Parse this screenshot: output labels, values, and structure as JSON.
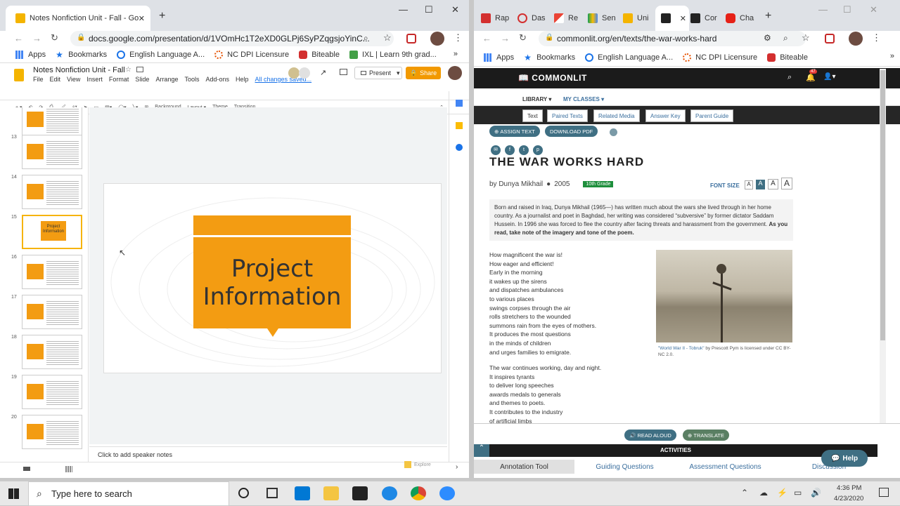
{
  "left_window": {
    "tabs": [
      {
        "title": "Notes Nonfiction Unit - Fall - Go"
      }
    ],
    "new_tab": "+",
    "url": "docs.google.com/presentation/d/1VOmHc1T2eXD0GLPj6SyPZqgsjoYinC...",
    "bookmarks": [
      {
        "label": "Apps"
      },
      {
        "label": "Bookmarks"
      },
      {
        "label": "English Language A..."
      },
      {
        "label": "NC DPI Licensure"
      },
      {
        "label": "Biteable"
      },
      {
        "label": "IXL | Learn 9th grad..."
      }
    ],
    "slides_app": {
      "doc_title": "Notes Nonfiction Unit - Fall",
      "menu": [
        "File",
        "Edit",
        "View",
        "Insert",
        "Format",
        "Slide",
        "Arrange",
        "Tools",
        "Add-ons",
        "Help"
      ],
      "saved_status": "All changes saved...",
      "present_label": "Present",
      "share_label": "Share",
      "toolbar": [
        "Background",
        "Layout ▾",
        "Theme",
        "Transition"
      ],
      "thumbnails": [
        {
          "num": ""
        },
        {
          "num": "13"
        },
        {
          "num": "14"
        },
        {
          "num": "15",
          "selected": true,
          "title": "Project Information"
        },
        {
          "num": "16"
        },
        {
          "num": "17"
        },
        {
          "num": "18"
        },
        {
          "num": "19"
        },
        {
          "num": "20"
        }
      ],
      "slide_title": "Project Information",
      "speaker_notes": "Click to add speaker notes",
      "explore_label": "Explore"
    }
  },
  "right_window": {
    "tabs": [
      {
        "title": "Rap"
      },
      {
        "title": "Das"
      },
      {
        "title": "Re"
      },
      {
        "title": "Sen"
      },
      {
        "title": "Uni"
      },
      {
        "title": ""
      },
      {
        "title": "Cor"
      },
      {
        "title": "Cha"
      }
    ],
    "new_tab": "+",
    "url": "commonlit.org/en/texts/the-war-works-hard",
    "bookmarks": [
      {
        "label": "Apps"
      },
      {
        "label": "Bookmarks"
      },
      {
        "label": "English Language A..."
      },
      {
        "label": "NC DPI Licensure"
      },
      {
        "label": "Biteable"
      }
    ],
    "commonlit": {
      "brand": "COMMONLIT",
      "notif_count": "47",
      "nav": [
        "LIBRARY ▾",
        "MY CLASSES ▾"
      ],
      "tabs": [
        "Text",
        "Paired Texts",
        "Related Media",
        "Answer Key",
        "Parent Guide"
      ],
      "assign_label": "ASSIGN TEXT",
      "pdf_label": "DOWNLOAD PDF",
      "title": "THE WAR WORKS HARD",
      "byline": "by Dunya Mikhail",
      "year": "2005",
      "grade": "10th Grade",
      "font_size_label": "FONT SIZE",
      "intro": "Born and raised in Iraq, Dunya Mikhail (1965—) has written much about the wars she lived through in her home country. As a journalist and poet in Baghdad, her writing was considered “subversive” by former dictator Saddam Hussein. In 1996 she was forced to flee the country after facing threats and harassment from the government.",
      "intro_bold": "As you read, take note of the imagery and tone of the poem.",
      "stanza1": [
        "How magnificent the war is!",
        "How eager and efficient!",
        "Early in the morning",
        "it wakes up the sirens",
        "and dispatches ambulances",
        "to various places",
        "swings corpses through the air",
        "rolls stretchers to the wounded",
        "summons rain from the eyes of mothers.",
        "It produces the most questions",
        "in the minds of children",
        "and urges families to emigrate."
      ],
      "stanza2": [
        "The war continues working, day and night.",
        "It inspires tyrants",
        "to deliver long speeches",
        "awards medals to generals",
        "and themes to poets.",
        "It contributes to the industry",
        "of artificial limbs"
      ],
      "caption_link": "\"World War II - Tobruk\"",
      "caption_rest": " by Prescott Pym is licensed under CC BY-NC 2.0.",
      "read_aloud": "READ ALOUD",
      "translate": "TRANSLATE",
      "activities": "ACTIVITIES",
      "activity_tabs": [
        "Annotation Tool",
        "Guiding Questions",
        "Assessment Questions",
        "Discussion"
      ],
      "help": "Help"
    }
  },
  "taskbar": {
    "search_placeholder": "Type here to search",
    "time": "4:36 PM",
    "date": "4/23/2020"
  },
  "colors": {
    "slides_orange": "#f39c12",
    "commonlit_teal": "#3f6f83",
    "grade_green": "#1e8f3c"
  }
}
